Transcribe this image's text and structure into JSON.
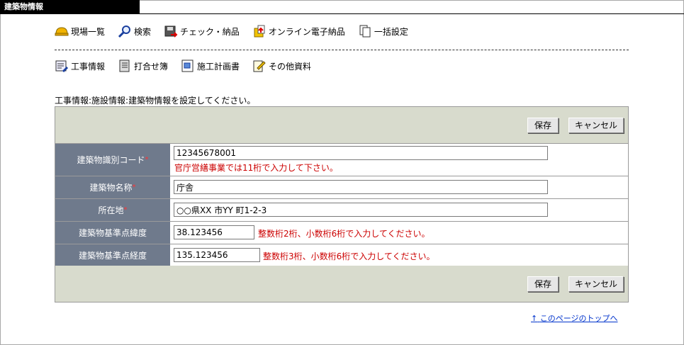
{
  "window": {
    "title": "建築物情報"
  },
  "menu1": [
    {
      "label": "現場一覧",
      "icon": "hard-hat-icon"
    },
    {
      "label": "検索",
      "icon": "magnifier-icon"
    },
    {
      "label": "チェック・納品",
      "icon": "floppy-check-icon"
    },
    {
      "label": "オンライン電子納品",
      "icon": "online-delivery-icon"
    },
    {
      "label": "一括設定",
      "icon": "copy-pages-icon"
    }
  ],
  "menu2": [
    {
      "label": "工事情報",
      "icon": "edit-list-icon"
    },
    {
      "label": "打合せ簿",
      "icon": "notebook-icon"
    },
    {
      "label": "施工計画書",
      "icon": "plan-document-icon"
    },
    {
      "label": "その他資料",
      "icon": "pencil-doc-icon"
    }
  ],
  "instruction": "工事情報:施設情報:建築物情報を設定してください。",
  "buttons": {
    "save": "保存",
    "cancel": "キャンセル"
  },
  "required_mark": "*",
  "form": {
    "building_id": {
      "label": "建築物識別コード",
      "required": true,
      "value": "12345678001",
      "note": "官庁営繕事業では11桁で入力して下さい。"
    },
    "building_name": {
      "label": "建築物名称",
      "required": true,
      "value": "庁舎"
    },
    "address": {
      "label": "所在地",
      "required": true,
      "value": "○○県XX 市YY 町1-2-3"
    },
    "latitude": {
      "label": "建築物基準点緯度",
      "required": false,
      "value": "38.123456",
      "note": "整数桁2桁、小数桁6桁で入力してください。"
    },
    "longitude": {
      "label": "建築物基準点経度",
      "required": false,
      "value": "135.123456",
      "note": "整数桁3桁、小数桁6桁で入力してください。"
    }
  },
  "page_top_link": "このページのトップへ",
  "colors": {
    "label_bg": "#6f7a8c",
    "bar_bg": "#d8dbcd",
    "error": "#cc0000",
    "link": "#0033cc"
  }
}
